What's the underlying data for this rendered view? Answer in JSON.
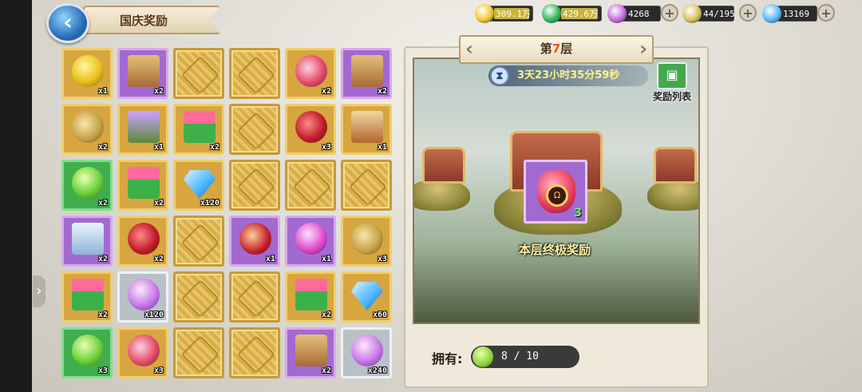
{
  "header": {
    "back_icon": "back-arrow-icon",
    "title": "国庆奖励"
  },
  "resources": [
    {
      "name": "gold",
      "icon": "gold-coin-icon",
      "color": "#f3c82b",
      "value": "309.1万"
    },
    {
      "name": "jade",
      "icon": "green-gem-icon",
      "color": "#2fb85a",
      "value": "429.6万"
    },
    {
      "name": "spirit",
      "icon": "purple-orb-icon",
      "color": "#c66ae0",
      "value": "4268"
    },
    {
      "name": "stamina",
      "icon": "wheat-icon",
      "color": "#d8c15a",
      "value": "44/195"
    },
    {
      "name": "diamond",
      "icon": "diamond-icon",
      "color": "#5ab8ff",
      "value": "13169"
    }
  ],
  "grid": {
    "cols": 6,
    "cells": [
      {
        "type": "item",
        "quality": "gold",
        "icon": "lantern-orb-icon",
        "qty": "x1"
      },
      {
        "type": "item",
        "quality": "purple",
        "icon": "hero-box-icon",
        "qty": "x2"
      },
      {
        "type": "hidden"
      },
      {
        "type": "hidden"
      },
      {
        "type": "item",
        "quality": "gold",
        "icon": "candy-bag-icon",
        "qty": "x2"
      },
      {
        "type": "item",
        "quality": "purple",
        "icon": "hero-box-icon",
        "qty": "x2"
      },
      {
        "type": "item",
        "quality": "gold",
        "icon": "money-bag-icon",
        "qty": "x2"
      },
      {
        "type": "item",
        "quality": "gold",
        "icon": "hero-card-icon",
        "qty": "x1"
      },
      {
        "type": "item",
        "quality": "gold",
        "icon": "gem-box-icon",
        "qty": "x2"
      },
      {
        "type": "hidden"
      },
      {
        "type": "item",
        "quality": "gold",
        "icon": "red-bag-icon",
        "qty": "x3"
      },
      {
        "type": "item",
        "quality": "gold",
        "icon": "portrait-card-icon",
        "qty": "x1"
      },
      {
        "type": "item",
        "quality": "green",
        "icon": "green-orb-icon",
        "qty": "x2"
      },
      {
        "type": "item",
        "quality": "gold",
        "icon": "gem-box-icon",
        "qty": "x2"
      },
      {
        "type": "item",
        "quality": "gold",
        "icon": "diamond-icon",
        "qty": "x120"
      },
      {
        "type": "hidden"
      },
      {
        "type": "hidden"
      },
      {
        "type": "hidden"
      },
      {
        "type": "item",
        "quality": "purple",
        "icon": "scroll-icon",
        "qty": "x2"
      },
      {
        "type": "item",
        "quality": "gold",
        "icon": "red-bag-icon",
        "qty": "x2"
      },
      {
        "type": "hidden"
      },
      {
        "type": "item",
        "quality": "purple",
        "icon": "heroes-bag-icon",
        "qty": "x1"
      },
      {
        "type": "item",
        "quality": "purple",
        "icon": "pink-orb-icon",
        "qty": "x1"
      },
      {
        "type": "item",
        "quality": "gold",
        "icon": "money-bag-icon",
        "qty": "x3"
      },
      {
        "type": "item",
        "quality": "gold",
        "icon": "gem-box-icon",
        "qty": "x2"
      },
      {
        "type": "item",
        "quality": "white",
        "icon": "purple-swirl-icon",
        "qty": "x120"
      },
      {
        "type": "hidden"
      },
      {
        "type": "hidden"
      },
      {
        "type": "item",
        "quality": "gold",
        "icon": "gem-box-icon",
        "qty": "x2"
      },
      {
        "type": "item",
        "quality": "gold",
        "icon": "diamond-icon",
        "qty": "x60"
      },
      {
        "type": "item",
        "quality": "green",
        "icon": "green-orb-icon",
        "qty": "x3"
      },
      {
        "type": "item",
        "quality": "gold",
        "icon": "candy-bag-icon",
        "qty": "x3"
      },
      {
        "type": "hidden"
      },
      {
        "type": "hidden"
      },
      {
        "type": "item",
        "quality": "purple",
        "icon": "hero-box-icon",
        "qty": "x2"
      },
      {
        "type": "item",
        "quality": "white",
        "icon": "purple-swirl-icon",
        "qty": "x240"
      }
    ]
  },
  "floor": {
    "prefix": "第",
    "number": "7",
    "suffix": "层",
    "timer": "3天23小时35分59秒",
    "timer_icon": "hourglass-icon",
    "reward_list_label": "奖励列表",
    "reward_list_icon": "gift-icon",
    "ultimate_item_icon": "lucky-bag-icon",
    "ultimate_item_qty": "3",
    "ultimate_label": "本层终极奖励",
    "owned_label": "拥有:",
    "owned_icon": "green-orb-icon",
    "owned_value": "8 / 10"
  }
}
